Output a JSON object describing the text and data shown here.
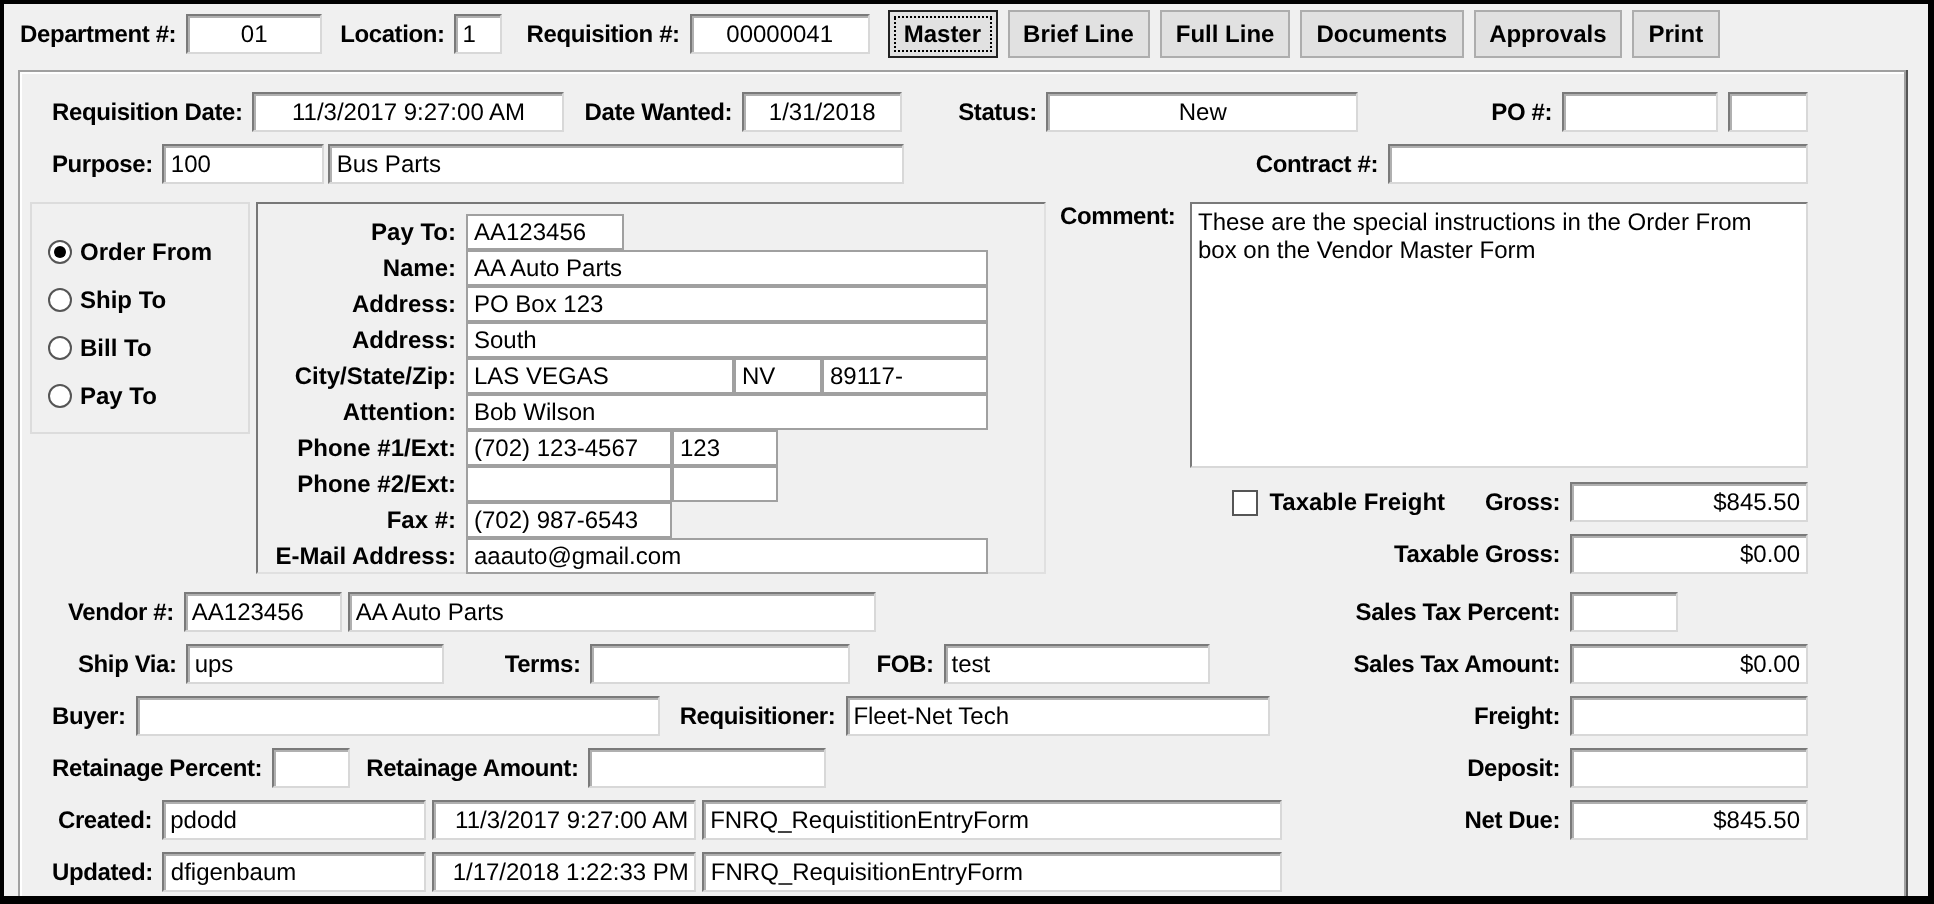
{
  "header": [
    {
      "label": "Department #:",
      "values": [
        "01"
      ]
    },
    {
      "label": "Location:",
      "values": [
        "1"
      ]
    },
    {
      "label": "Requisition #:",
      "values": [
        "00000041"
      ]
    }
  ],
  "toolbar": [
    {
      "label": "Master",
      "selected": true
    },
    {
      "label": "Brief Line",
      "selected": false
    },
    {
      "label": "Full Line",
      "selected": false
    },
    {
      "label": "Documents",
      "selected": false
    },
    {
      "label": "Approvals",
      "selected": false
    },
    {
      "label": "Print",
      "selected": false
    }
  ],
  "dates_row": [
    {
      "label": "Requisition Date:",
      "values": [
        "11/3/2017 9:27:00 AM"
      ]
    },
    {
      "label": "Date Wanted:",
      "values": [
        "1/31/2018"
      ]
    },
    {
      "label": "Status:",
      "values": [
        "New"
      ]
    },
    {
      "label": "PO #:"
    }
  ],
  "purpose_row": [
    {
      "label": "Purpose:",
      "values": [
        "100",
        "Bus Parts"
      ]
    },
    {
      "label": "Contract #:"
    }
  ],
  "address_type": [
    {
      "label": "Order From",
      "selected": true
    },
    {
      "label": "Ship To",
      "selected": false
    },
    {
      "label": "Bill To",
      "selected": false
    },
    {
      "label": "Pay To",
      "selected": false
    }
  ],
  "address": [
    {
      "label": "Pay To:",
      "values": [
        "AA123456"
      ]
    },
    {
      "label": "Name:",
      "values": [
        "AA Auto Parts"
      ]
    },
    {
      "label": "Address:",
      "values": [
        "PO Box 123"
      ]
    },
    {
      "label": "Address:",
      "values": [
        "South"
      ]
    },
    {
      "label": "City/State/Zip:",
      "values": [
        "LAS VEGAS",
        "NV",
        "89117-"
      ]
    },
    {
      "label": "Attention:",
      "values": [
        "Bob Wilson"
      ]
    },
    {
      "label": "Phone #1/Ext:",
      "values": [
        "(702) 123-4567",
        "123"
      ]
    },
    {
      "label": "Phone #2/Ext:"
    },
    {
      "label": "Fax #:",
      "values": [
        "(702) 987-6543"
      ]
    },
    {
      "label": "E-Mail Address:",
      "values": [
        "aaauto@gmail.com"
      ]
    }
  ],
  "comment": {
    "label": "Comment:",
    "value": "These are the special instructions in the Order From\nbox on the Vendor Master Form"
  },
  "taxable_freight": {
    "label": "Taxable Freight",
    "checked": false
  },
  "totals": [
    {
      "label": "Gross:",
      "values": [
        "$845.50"
      ]
    },
    {
      "label": "Taxable Gross:",
      "values": [
        "$0.00"
      ]
    },
    {
      "label": "Sales Tax Percent:"
    },
    {
      "label": "Sales Tax Amount:",
      "values": [
        "$0.00"
      ]
    },
    {
      "label": "Freight:"
    },
    {
      "label": "Deposit:"
    },
    {
      "label": "Net Due:",
      "values": [
        "$845.50"
      ]
    }
  ],
  "detail_rows": [
    [
      {
        "label": "Vendor #:",
        "values": [
          "AA123456",
          "AA Auto Parts"
        ]
      }
    ],
    [
      {
        "label": "Ship Via:",
        "values": [
          "ups"
        ]
      },
      {
        "label": "Terms:"
      },
      {
        "label": "FOB:",
        "values": [
          "test"
        ]
      }
    ],
    [
      {
        "label": "Buyer:"
      },
      {
        "label": "Requisitioner:",
        "values": [
          "Fleet-Net Tech"
        ]
      }
    ],
    [
      {
        "label": "Retainage Percent:"
      },
      {
        "label": "Retainage Amount:"
      }
    ],
    [
      {
        "label": "Created:",
        "values": [
          "pdodd",
          "11/3/2017 9:27:00 AM",
          "FNRQ_RequistitionEntryForm"
        ]
      }
    ],
    [
      {
        "label": "Updated:",
        "values": [
          "dfigenbaum",
          "1/17/2018 1:22:33 PM",
          "FNRQ_RequisitionEntryForm"
        ]
      }
    ]
  ]
}
